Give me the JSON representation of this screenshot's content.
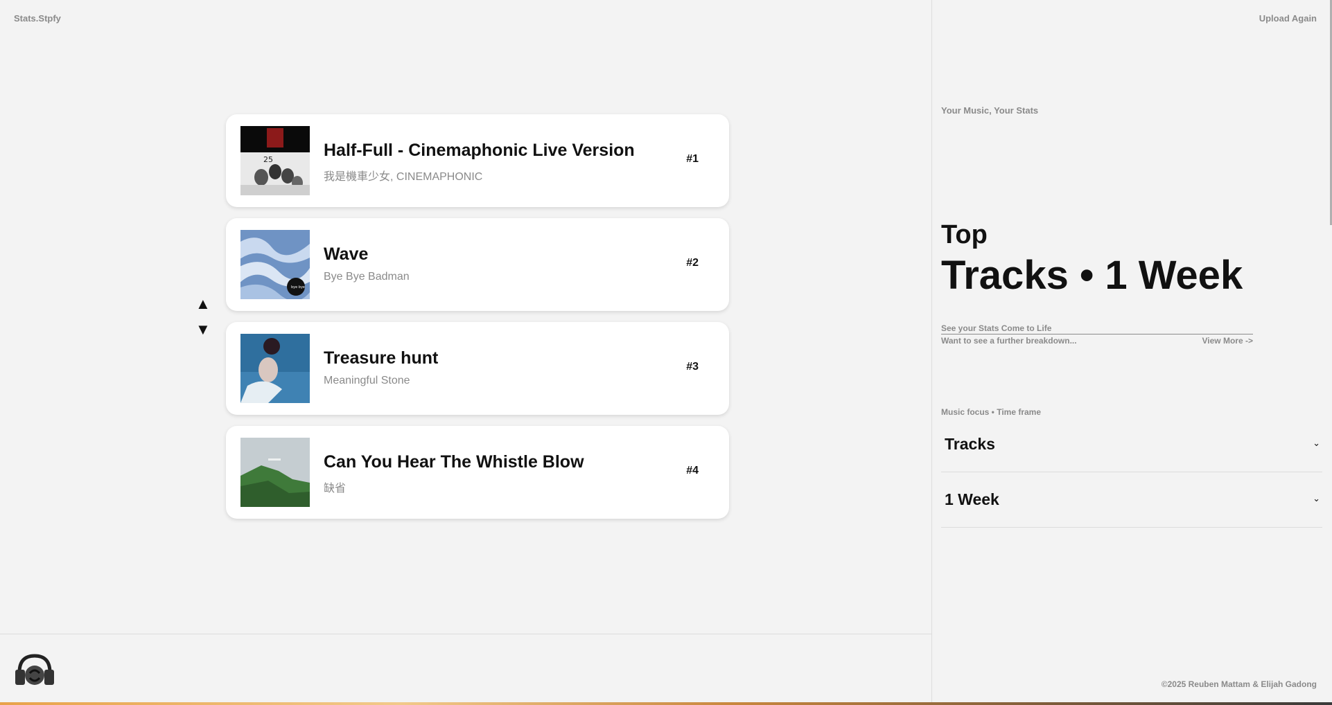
{
  "header": {
    "brand": "Stats.Stpfy",
    "upload_again": "Upload Again"
  },
  "tracks": [
    {
      "title": "Half-Full - Cinemaphonic Live Version",
      "artist": "我是機車少女, CINEMAPHONIC",
      "rank": "#1"
    },
    {
      "title": "Wave",
      "artist": "Bye Bye Badman",
      "rank": "#2"
    },
    {
      "title": "Treasure hunt",
      "artist": "Meaningful Stone",
      "rank": "#3"
    },
    {
      "title": "Can You Hear The Whistle Blow",
      "artist": "缺省",
      "rank": "#4"
    }
  ],
  "reorder": {
    "up": "▲",
    "down": "▼"
  },
  "sidebar": {
    "tagline": "Your Music, Your Stats",
    "heading_top": "Top",
    "heading_main": "Tracks • 1 Week",
    "cta_title": "See your Stats Come to Life",
    "cta_text": "Want to see a further breakdown...",
    "cta_link": "View More ->",
    "filters_label": "Music focus • Time frame",
    "focus_value": "Tracks",
    "timeframe_value": "1 Week",
    "chevron": "⌄"
  },
  "footer": {
    "copyright": "©2025 Reuben Mattam & Elijah Gadong"
  },
  "icons": {
    "logo": "headphones-logo-icon",
    "up": "arrow-up-icon",
    "down": "arrow-down-icon",
    "chevron": "chevron-down-icon"
  }
}
